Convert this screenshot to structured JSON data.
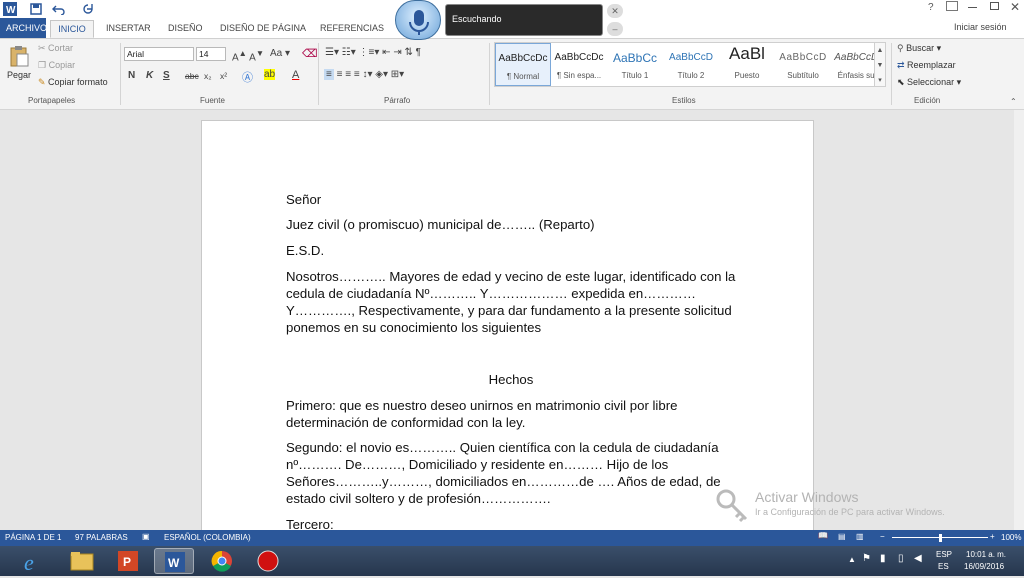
{
  "tabs": [
    "ARCHIVO",
    "INICIO",
    "INSERTAR",
    "DISEÑO",
    "DISEÑO DE PÁGINA",
    "REFERENCIAS"
  ],
  "titlebar": {
    "sign_in": "Iniciar sesión",
    "help": "?"
  },
  "speech": {
    "status": "Escuchando"
  },
  "clipboard": {
    "paste": "Pegar",
    "cut": "Cortar",
    "copy": "Copiar",
    "format_painter": "Copiar formato",
    "label": "Portapapeles"
  },
  "font": {
    "name": "Arial",
    "size": "14",
    "label": "Fuente",
    "bold": "N",
    "italic": "K",
    "underline": "S",
    "strike": "abc",
    "sub": "x₂",
    "sup": "x²"
  },
  "paragraph": {
    "label": "Párrafo"
  },
  "styles": {
    "label": "Estilos",
    "items": [
      {
        "preview": "AaBbCcDc",
        "name": "¶ Normal"
      },
      {
        "preview": "AaBbCcDc",
        "name": "¶ Sin espa..."
      },
      {
        "preview": "AaBbCc",
        "name": "Título 1"
      },
      {
        "preview": "AaBbCcD",
        "name": "Título 2"
      },
      {
        "preview": "AaBl",
        "name": "Puesto"
      },
      {
        "preview": "AaBbCcD",
        "name": "Subtítulo"
      },
      {
        "preview": "AaBbCcDd",
        "name": "Énfasis sutil"
      }
    ]
  },
  "editing": {
    "find": "Buscar",
    "replace": "Reemplazar",
    "select": "Seleccionar",
    "label": "Edición"
  },
  "document": {
    "p1": "Señor",
    "p2": "Juez civil (o promiscuo) municipal  de…….. (Reparto)",
    "p3": "E.S.D.",
    "p4": "Nosotros……….. Mayores de edad y vecino de este lugar, identificado con la cedula de ciudadanía Nº……….. Y……………… expedida en………… Y…………., Respectivamente, y para dar fundamento a la presente solicitud ponemos en su conocimiento los siguientes",
    "p5": "Hechos",
    "p6": "Primero: que es nuestro deseo unirnos en matrimonio civil por libre determinación de conformidad con la ley.",
    "p7": "Segundo: el novio es……….. Quien científica con la cedula de ciudadanía nº………. De………, Domiciliado y residente en……… Hijo de los Señores………..y………, domiciliados en…………de   …. Años de edad, de estado civil soltero y de profesión…………….",
    "p8": "Tercero:"
  },
  "watermark": {
    "title": "Activar Windows",
    "subtitle": "Ir a Configuración de PC para activar Windows."
  },
  "status": {
    "page": "PÁGINA 1 DE 1",
    "words": "97 PALABRAS",
    "language": "ESPAÑOL (COLOMBIA)",
    "zoom": "100%"
  },
  "taskbar": {
    "lang1": "ESP",
    "lang2": "ES",
    "time": "10:01 a. m.",
    "date": "16/09/2016"
  },
  "colors": {
    "accent": "#2b579a"
  }
}
